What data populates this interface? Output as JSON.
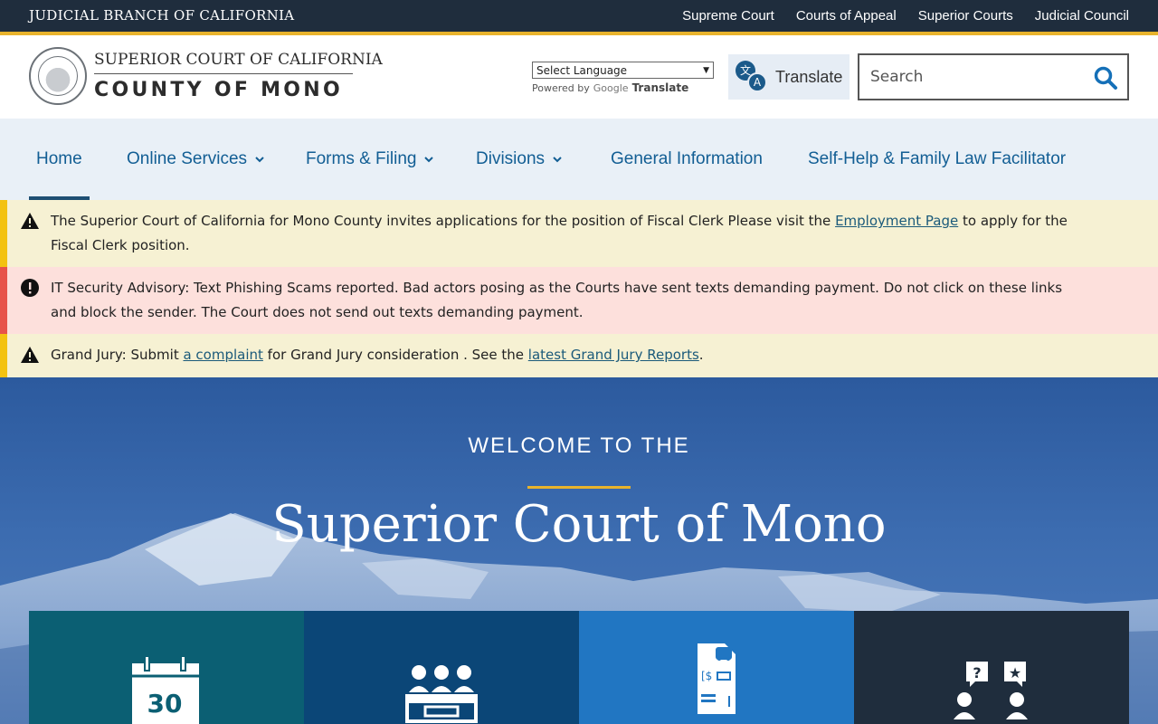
{
  "topbar": {
    "brand": "JUDICIAL BRANCH OF CALIFORNIA",
    "links": [
      "Supreme Court",
      "Courts of Appeal",
      "Superior Courts",
      "Judicial Council"
    ]
  },
  "header": {
    "title_line1": "SUPERIOR COURT OF CALIFORNIA",
    "title_line2": "COUNTY OF MONO",
    "language_select": "Select Language",
    "powered_by": "Powered by",
    "google": "Google",
    "google_translate": "Translate",
    "translate_button": "Translate",
    "search_placeholder": "Search"
  },
  "nav": {
    "items": [
      {
        "label": "Home",
        "active": true
      },
      {
        "label": "Online Services",
        "dropdown": true
      },
      {
        "label": "Forms & Filing",
        "dropdown": true
      },
      {
        "label": "Divisions",
        "dropdown": true
      },
      {
        "label": "General Information"
      },
      {
        "label": "Self-Help & Family Law Facilitator"
      }
    ]
  },
  "alerts": [
    {
      "type": "warning",
      "text_before": "The Superior Court of California for Mono County invites applications for the position of Fiscal Clerk Please visit the ",
      "link": "Employment Page",
      "text_after": " to apply for the Fiscal Clerk position."
    },
    {
      "type": "danger",
      "text": "IT Security Advisory: Text Phishing Scams reported. Bad actors posing as the Courts have sent texts demanding payment. Do not click on these links and block the sender. The Court does not send out texts demanding payment."
    },
    {
      "type": "warning",
      "text_before": "Grand Jury: Submit ",
      "link1": "a complaint",
      "text_middle": " for Grand Jury consideration .  See the ",
      "link2": "latest Grand Jury Reports",
      "text_after": "."
    }
  ],
  "hero": {
    "welcome": "WELCOME TO THE",
    "title": "Superior Court of Mono"
  },
  "tiles": [
    {
      "icon": "calendar-icon",
      "number": "30",
      "color": "#0b5f73"
    },
    {
      "icon": "jury-icon",
      "color": "#0b4677"
    },
    {
      "icon": "traffic-ticket-icon",
      "color": "#2176c2"
    },
    {
      "icon": "self-help-icon",
      "color": "#1f2d3d"
    }
  ],
  "colors": {
    "topbar": "#1f2d3d",
    "accent_gold": "#e8b32c",
    "nav_bg": "#e9f0f7",
    "link_blue": "#125e94"
  }
}
